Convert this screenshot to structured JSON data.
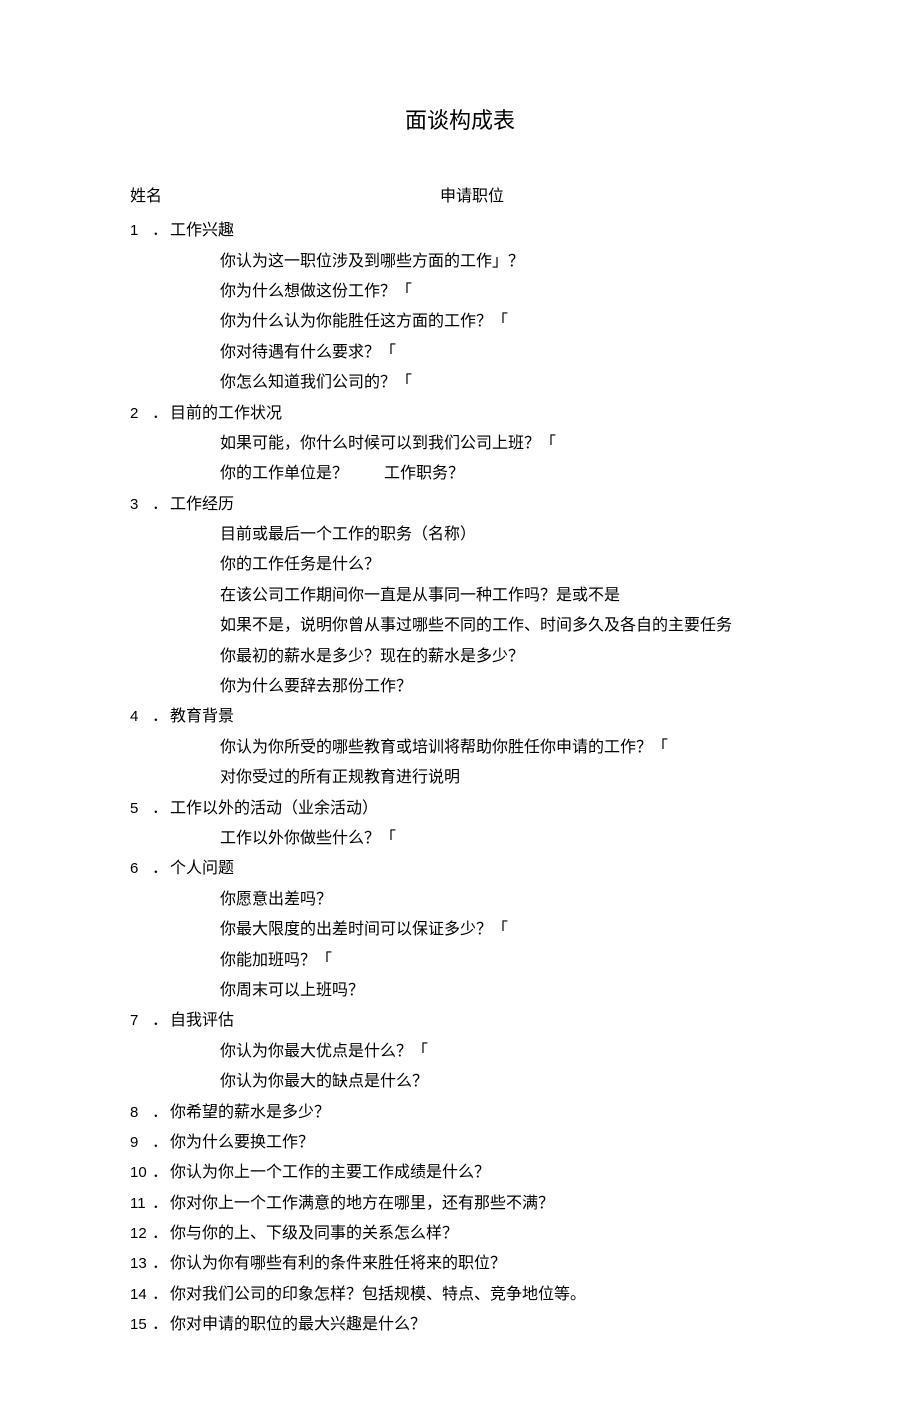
{
  "title": "面谈构成表",
  "header": {
    "name_label": "姓名",
    "position_label": "申请职位"
  },
  "s1": {
    "num": "1",
    "dot": "．",
    "heading": "工作兴趣",
    "q1": "你认为这一职位涉及到哪些方面的工作」？",
    "q2": "你为什么想做这份工作？「",
    "q3": "你为什么认为你能胜任这方面的工作？「",
    "q4": "你对待遇有什么要求？「",
    "q5": "你怎么知道我们公司的？「"
  },
  "s2": {
    "num": "2",
    "dot": "．",
    "heading": "目前的工作状况",
    "q1": "如果可能，你什么时候可以到我们公司上班？「",
    "q2a": "你的工作单位是？",
    "q2b": "工作职务？"
  },
  "s3": {
    "num": "3",
    "dot": "．",
    "heading": "工作经历",
    "q1": "目前或最后一个工作的职务（名称）",
    "q2": "你的工作任务是什么？",
    "q3": "在该公司工作期间你一直是从事同一种工作吗？是或不是",
    "q4": "如果不是，说明你曾从事过哪些不同的工作、时间多久及各自的主要任务",
    "q5": "你最初的薪水是多少？现在的薪水是多少？",
    "q6": "你为什么要辞去那份工作？"
  },
  "s4": {
    "num": "4",
    "dot": "．",
    "heading": "教育背景",
    "q1": "你认为你所受的哪些教育或培训将帮助你胜任你申请的工作？「",
    "q2": "对你受过的所有正规教育进行说明"
  },
  "s5": {
    "num": "5",
    "dot": "．",
    "heading": "工作以外的活动（业余活动）",
    "q1": "工作以外你做些什么？「"
  },
  "s6": {
    "num": "6",
    "dot": "．",
    "heading": "个人问题",
    "q1": "你愿意出差吗？",
    "q2": "你最大限度的出差时间可以保证多少？「",
    "q3": "你能加班吗？「",
    "q4": "你周末可以上班吗？"
  },
  "s7": {
    "num": "7",
    "dot": "．",
    "heading": "自我评估",
    "q1": "你认为你最大优点是什么？「",
    "q2": "你认为你最大的缺点是什么？"
  },
  "s8": {
    "num": "8",
    "dot": "．",
    "text": "你希望的薪水是多少？"
  },
  "s9": {
    "num": "9",
    "dot": "．",
    "text": "你为什么要换工作？"
  },
  "s10": {
    "num": "10",
    "dot": "．",
    "text": "你认为你上一个工作的主要工作成绩是什么？"
  },
  "s11": {
    "num": "11",
    "dot": "．",
    "text": "你对你上一个工作满意的地方在哪里，还有那些不满？"
  },
  "s12": {
    "num": "12",
    "dot": "．",
    "text": "你与你的上、下级及同事的关系怎么样？"
  },
  "s13": {
    "num": "13",
    "dot": "．",
    "text": "你认为你有哪些有利的条件来胜任将来的职位？"
  },
  "s14": {
    "num": "14",
    "dot": "．",
    "text": "你对我们公司的印象怎样？包括规模、特点、竞争地位等。"
  },
  "s15": {
    "num": "15",
    "dot": "．",
    "text": "你对申请的职位的最大兴趣是什么？"
  }
}
